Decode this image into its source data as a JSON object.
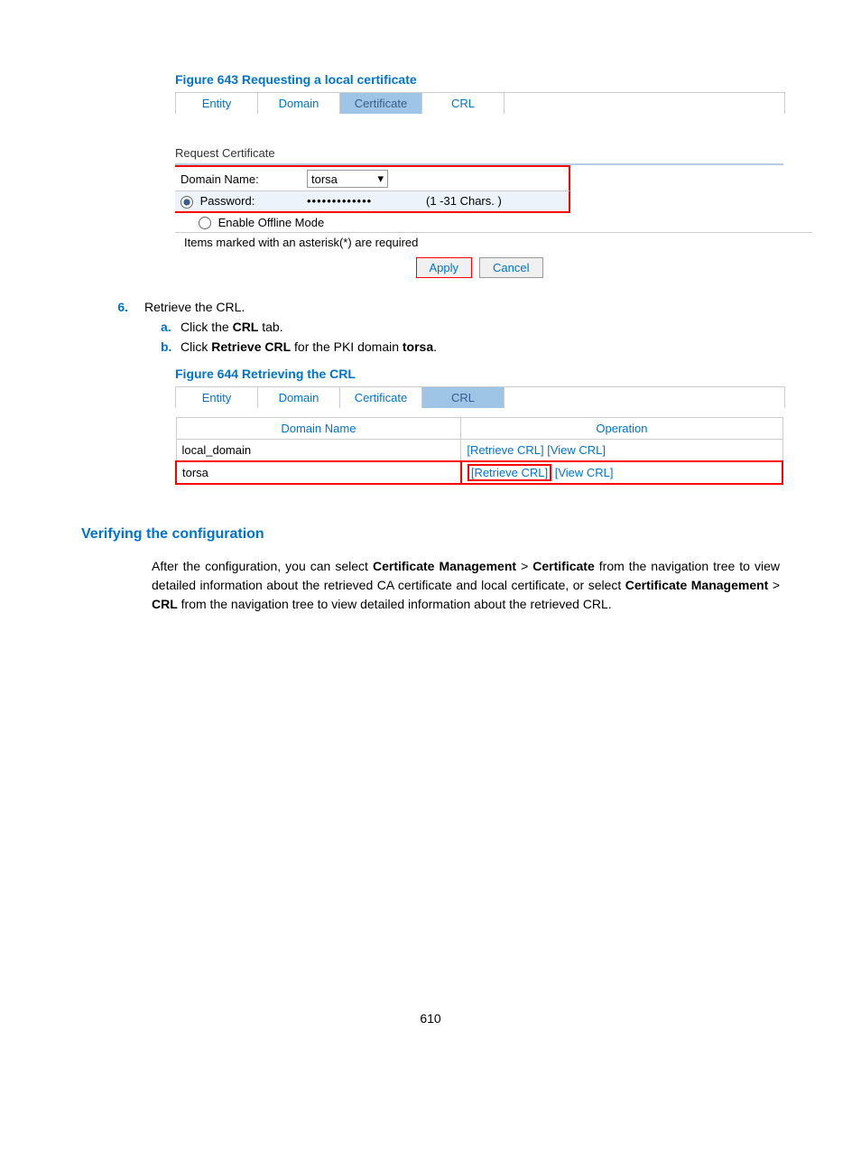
{
  "figure643": {
    "caption": "Figure 643 Requesting a local certificate",
    "tabs": [
      "Entity",
      "Domain",
      "Certificate",
      "CRL"
    ],
    "active_tab": "Certificate",
    "section_title": "Request Certificate",
    "domain_label": "Domain Name:",
    "domain_value": "torsa",
    "password_label": "Password:",
    "password_value": "•••••••••••••",
    "password_hint": "(1 -31 Chars. )",
    "offline_label": "Enable Offline Mode",
    "required_note": "Items marked with an asterisk(*) are required",
    "apply": "Apply",
    "cancel": "Cancel"
  },
  "step6": {
    "number": "6.",
    "text": "Retrieve the CRL.",
    "a_letter": "a.",
    "a_text_pre": "Click the ",
    "a_bold": "CRL",
    "a_text_post": " tab.",
    "b_letter": "b.",
    "b_text_pre": "Click ",
    "b_bold1": "Retrieve CRL",
    "b_text_mid": " for the PKI domain ",
    "b_bold2": "torsa",
    "b_text_post": "."
  },
  "figure644": {
    "caption": "Figure 644 Retrieving the CRL",
    "tabs": [
      "Entity",
      "Domain",
      "Certificate",
      "CRL"
    ],
    "active_tab": "CRL",
    "col1": "Domain Name",
    "col2": "Operation",
    "rows": [
      {
        "name": "local_domain",
        "retrieve": "[Retrieve CRL]",
        "view": "[View CRL]"
      },
      {
        "name": "torsa",
        "retrieve": "[Retrieve CRL]",
        "view": "[View CRL]"
      }
    ]
  },
  "verify": {
    "heading": "Verifying the configuration",
    "text_pre": "After the configuration, you can select ",
    "b1": "Certificate Management",
    "gt1": " > ",
    "b2": "Certificate",
    "text_mid1": " from the navigation tree to view detailed information about the retrieved CA certificate and local certificate, or select ",
    "b3": "Certificate Management",
    "gt2": " > ",
    "b4": "CRL",
    "text_post": " from the navigation tree to view detailed information about the retrieved CRL."
  },
  "page_number": "610"
}
